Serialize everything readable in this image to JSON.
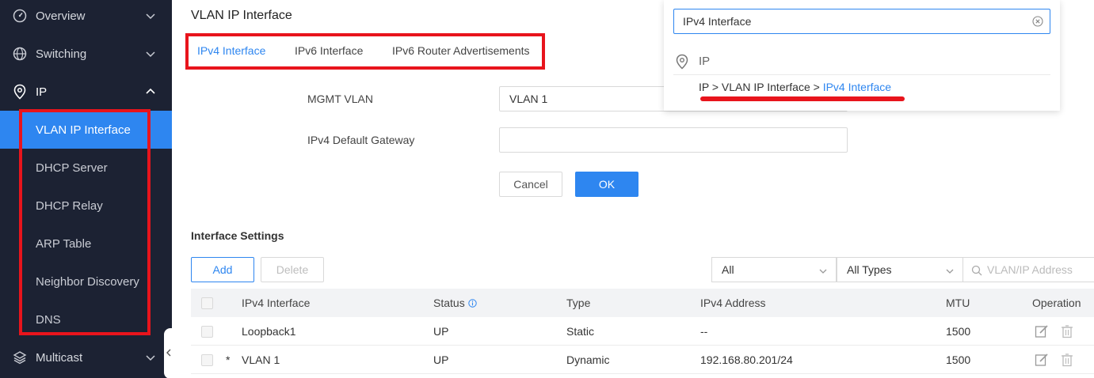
{
  "sidebar": {
    "top_items": [
      {
        "label": "Overview",
        "icon": "dashboard-icon"
      },
      {
        "label": "Switching",
        "icon": "globe-icon"
      },
      {
        "label": "IP",
        "icon": "location-pin-icon"
      }
    ],
    "sub_items": [
      {
        "label": "VLAN IP Interface",
        "active": true
      },
      {
        "label": "DHCP Server"
      },
      {
        "label": "DHCP Relay"
      },
      {
        "label": "ARP Table"
      },
      {
        "label": "Neighbor Discovery"
      },
      {
        "label": "DNS"
      }
    ],
    "bottom_items": [
      {
        "label": "Multicast",
        "icon": "layers-icon"
      }
    ]
  },
  "page": {
    "title": "VLAN IP Interface",
    "tabs": [
      {
        "label": "IPv4 Interface",
        "active": true
      },
      {
        "label": "IPv6 Interface"
      },
      {
        "label": "IPv6 Router Advertisements"
      }
    ]
  },
  "form": {
    "mgmt_vlan_label": "MGMT VLAN",
    "mgmt_vlan_value": "VLAN 1",
    "gateway_label": "IPv4 Default Gateway",
    "gateway_value": "",
    "cancel_label": "Cancel",
    "ok_label": "OK"
  },
  "interface_settings": {
    "title": "Interface Settings",
    "add_label": "Add",
    "delete_label": "Delete",
    "filter_status": "All",
    "filter_type": "All Types",
    "search_placeholder": "VLAN/IP Address",
    "columns": [
      "IPv4 Interface",
      "Status",
      "Type",
      "IPv4 Address",
      "MTU",
      "Operation"
    ],
    "rows": [
      {
        "marker": "",
        "interface": "Loopback1",
        "status": "UP",
        "type": "Static",
        "address": "--",
        "mtu": "1500"
      },
      {
        "marker": "*",
        "interface": "VLAN 1",
        "status": "UP",
        "type": "Dynamic",
        "address": "192.168.80.201/24",
        "mtu": "1500"
      }
    ]
  },
  "search_popup": {
    "query": "IPv4 Interface",
    "group_label": "IP",
    "result_prefix": "IP > VLAN IP Interface > ",
    "result_highlight": "IPv4 Interface"
  },
  "colors": {
    "sidebar_bg": "#1c2233",
    "accent": "#2e86f0",
    "annotation_red": "#e8141c"
  }
}
